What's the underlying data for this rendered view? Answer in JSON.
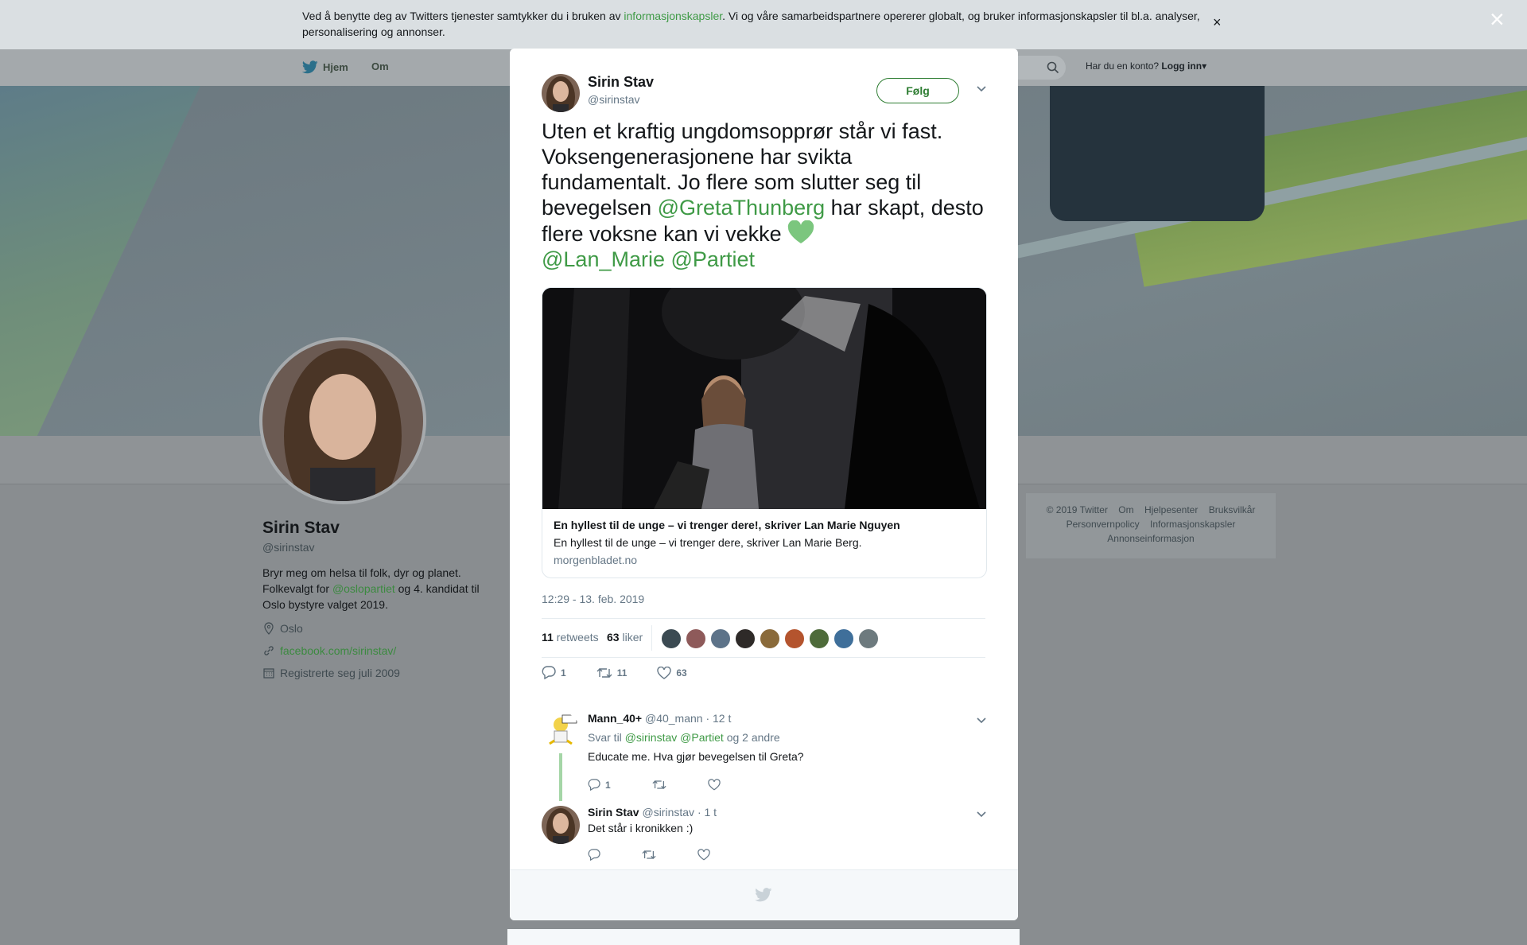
{
  "cookie_bar": {
    "text_before": "Ved å benytte deg av Twitters tjenester samtykker du i bruken av ",
    "link": "informasjonskapsler",
    "text_after": ". Vi og våre samarbeidspartnere opererer globalt, og bruker informasjonskapsler til bl.a. analyser, personalisering og annonser.",
    "close": "×"
  },
  "nav": {
    "home": "Hjem",
    "about": "Om",
    "account_prompt": "Har du en konto?",
    "login": "Logg inn",
    "login_caret": "▾"
  },
  "profile": {
    "name": "Sirin Stav",
    "handle": "@sirinstav",
    "bio_1": "Bryr meg om helsa til folk, dyr og planet. Folkevalgt for ",
    "bio_link": "@oslopartiet",
    "bio_2": " og 4. kandidat til Oslo bystyre valget 2019.",
    "location": "Oslo",
    "website": "facebook.com/sirinstav/",
    "joined": "Registrerte seg juli 2009"
  },
  "footer": {
    "links": [
      "© 2019 Twitter",
      "Om",
      "Hjelpesenter",
      "Bruksvilkår",
      "Personvernpolicy",
      "Informasjonskapsler",
      "Annonseinformasjon"
    ]
  },
  "overlay_close": "×",
  "tweet": {
    "name": "Sirin Stav",
    "handle": "@sirinstav",
    "follow": "Følg",
    "text_1": "Uten et kraftig ungdomsopprør står vi fast. Voksengenerasjonene har svikta fundamentalt. Jo flere som slutter seg til bevegelsen ",
    "mention_greta": "@GretaThunberg",
    "text_2": " har skapt, desto flere voksne kan vi vekke ",
    "mention_lan": "@Lan_Marie",
    "mention_partiet": "@Partiet",
    "card_title": "En hyllest til de unge – vi trenger dere!, skriver Lan Marie Nguyen",
    "card_desc": "En hyllest til de unge – vi trenger dere, skriver Lan Marie Berg.",
    "card_domain": "morgenbladet.no",
    "timestamp": "12:29 - 13. feb. 2019",
    "retweets_count": "11",
    "retweets_label": "retweets",
    "likes_count": "63",
    "likes_label": "liker",
    "reply_count": "1",
    "retweet_count": "11",
    "like_count": "63"
  },
  "replies": [
    {
      "name": "Mann_40+",
      "handle": "@40_mann",
      "time": "· 12 t",
      "reply_to_prefix": "Svar til ",
      "reply_to_1": "@sirinstav",
      "reply_to_2": "@Partiet",
      "reply_to_suffix": " og 2 andre",
      "text": "Educate me. Hva gjør bevegelsen til Greta?",
      "reply_count": "1"
    },
    {
      "name": "Sirin Stav",
      "handle": "@sirinstav",
      "time": "· 1 t",
      "text": "Det står i kronikken :)"
    }
  ],
  "colors": {
    "accent": "#3f9a46",
    "overlay": "#898d90",
    "modal_bg": "#ffffff"
  }
}
